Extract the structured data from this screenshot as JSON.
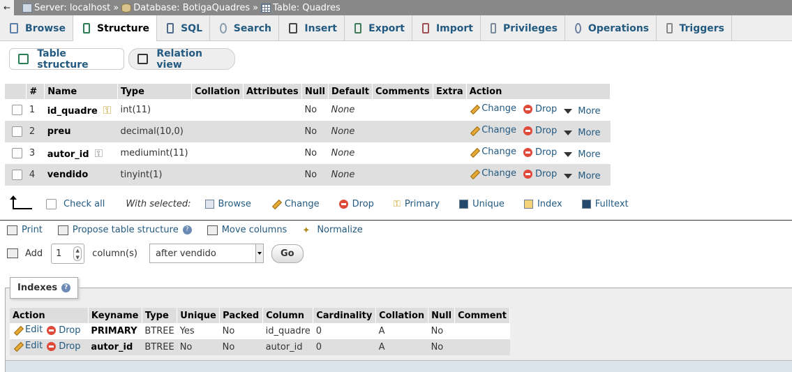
{
  "breadcrumb": {
    "back": "←",
    "server": "Server: localhost",
    "database": "Database: BotigaQuadres",
    "table": "Table: Quadres",
    "sep": "»"
  },
  "tabs": [
    {
      "label": "Browse",
      "icon": "browse-icon",
      "color": "#5a7fa8"
    },
    {
      "label": "Structure",
      "icon": "structure-icon",
      "color": "#2b7d54"
    },
    {
      "label": "SQL",
      "icon": "sql-icon",
      "color": "#4d6a8a"
    },
    {
      "label": "Search",
      "icon": "search-icon",
      "color": "#8a9bb0"
    },
    {
      "label": "Insert",
      "icon": "insert-icon",
      "color": "#444444"
    },
    {
      "label": "Export",
      "icon": "export-icon",
      "color": "#3d7d5a"
    },
    {
      "label": "Import",
      "icon": "import-icon",
      "color": "#a05050"
    },
    {
      "label": "Privileges",
      "icon": "privileges-icon",
      "color": "#7a8a9a"
    },
    {
      "label": "Operations",
      "icon": "operations-icon",
      "color": "#6a7fa0"
    },
    {
      "label": "Triggers",
      "icon": "triggers-icon",
      "color": "#888888"
    }
  ],
  "subtabs": {
    "table_structure": "Table structure",
    "relation_view": "Relation view"
  },
  "structure": {
    "headers": [
      "#",
      "Name",
      "Type",
      "Collation",
      "Attributes",
      "Null",
      "Default",
      "Comments",
      "Extra",
      "Action"
    ],
    "rows": [
      {
        "num": "1",
        "name": "id_quadre",
        "type": "int(11)",
        "null": "No",
        "default": "None",
        "key": "primary"
      },
      {
        "num": "2",
        "name": "preu",
        "type": "decimal(10,0)",
        "null": "No",
        "default": "None",
        "key": ""
      },
      {
        "num": "3",
        "name": "autor_id",
        "type": "mediumint(11)",
        "null": "No",
        "default": "None",
        "key": "index"
      },
      {
        "num": "4",
        "name": "vendido",
        "type": "tinyint(1)",
        "null": "No",
        "default": "None",
        "key": ""
      }
    ],
    "actions": {
      "change": "Change",
      "drop": "Drop",
      "more": "More"
    }
  },
  "with_selected": {
    "check_all": "Check all",
    "label": "With selected:",
    "browse": "Browse",
    "change": "Change",
    "drop": "Drop",
    "primary": "Primary",
    "unique": "Unique",
    "index": "Index",
    "fulltext": "Fulltext"
  },
  "tools": {
    "print": "Print",
    "propose": "Propose table structure",
    "move": "Move columns",
    "normalize": "Normalize"
  },
  "add_column": {
    "add": "Add",
    "count": "1",
    "columns_label": "column(s)",
    "position": "after vendido",
    "go": "Go"
  },
  "indexes": {
    "title": "Indexes",
    "headers": [
      "Action",
      "Keyname",
      "Type",
      "Unique",
      "Packed",
      "Column",
      "Cardinality",
      "Collation",
      "Null",
      "Comment"
    ],
    "actions": {
      "edit": "Edit",
      "drop": "Drop"
    },
    "rows": [
      {
        "keyname": "PRIMARY",
        "type": "BTREE",
        "unique": "Yes",
        "packed": "No",
        "column": "id_quadre",
        "cardinality": "0",
        "collation": "A",
        "null": "No",
        "comment": ""
      },
      {
        "keyname": "autor_id",
        "type": "BTREE",
        "unique": "No",
        "packed": "No",
        "column": "autor_id",
        "cardinality": "0",
        "collation": "A",
        "null": "No",
        "comment": ""
      }
    ]
  }
}
